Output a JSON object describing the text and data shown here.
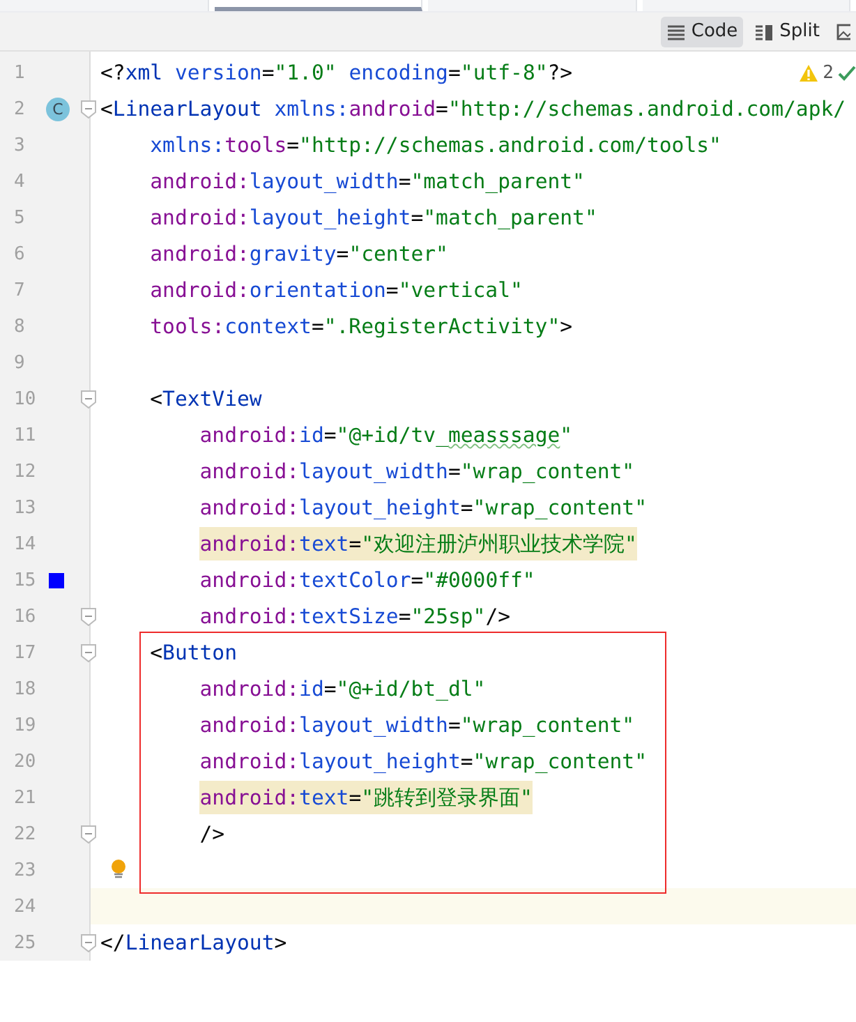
{
  "tabs": [
    {
      "selected": false
    },
    {
      "selected": true
    },
    {
      "selected": false
    },
    {
      "selected": false
    }
  ],
  "view_modes": [
    {
      "label": "Code",
      "kind": "code",
      "selected": true
    },
    {
      "label": "Split",
      "kind": "split",
      "selected": false
    },
    {
      "kind": "design",
      "selected": false
    }
  ],
  "inspections": {
    "warnings": "2"
  },
  "lines": [
    {
      "number": "1",
      "kind": "top",
      "highlighted": false,
      "tokens": [
        {
          "kind": "punct",
          "text": "<?"
        },
        {
          "kind": "tag",
          "text": "xml "
        },
        {
          "kind": "attr",
          "text": "version"
        },
        {
          "kind": "punct",
          "text": "="
        },
        {
          "kind": "value",
          "text": "\"1.0\" "
        },
        {
          "kind": "attr",
          "text": "encoding"
        },
        {
          "kind": "punct",
          "text": "="
        },
        {
          "kind": "value",
          "text": "\"utf-8\""
        },
        {
          "kind": "punct",
          "text": "?>"
        }
      ]
    },
    {
      "number": "2",
      "kind": "top",
      "badge": "C",
      "fold": true,
      "highlighted": false,
      "tokens": [
        {
          "kind": "punct",
          "text": "<"
        },
        {
          "kind": "tag",
          "text": "LinearLayout "
        },
        {
          "kind": "attr",
          "text": "xmlns:"
        },
        {
          "kind": "ns",
          "text": "android"
        },
        {
          "kind": "punct",
          "text": "="
        },
        {
          "kind": "value",
          "text": "\"http://schemas.android.com/apk/"
        }
      ]
    },
    {
      "number": "3",
      "kind": "nested",
      "highlighted": false,
      "tokens": [
        {
          "kind": "attr",
          "text": "xmlns:"
        },
        {
          "kind": "ns",
          "text": "tools"
        },
        {
          "kind": "punct",
          "text": "="
        },
        {
          "kind": "value",
          "text": "\"http://schemas.android.com/tools\""
        }
      ]
    },
    {
      "number": "4",
      "kind": "nested",
      "highlighted": false,
      "tokens": [
        {
          "kind": "ns",
          "text": "android:"
        },
        {
          "kind": "attr",
          "text": "layout_width"
        },
        {
          "kind": "punct",
          "text": "="
        },
        {
          "kind": "value",
          "text": "\"match_parent\""
        }
      ]
    },
    {
      "number": "5",
      "kind": "nested",
      "highlighted": false,
      "tokens": [
        {
          "kind": "ns",
          "text": "android:"
        },
        {
          "kind": "attr",
          "text": "layout_height"
        },
        {
          "kind": "punct",
          "text": "="
        },
        {
          "kind": "value",
          "text": "\"match_parent\""
        }
      ]
    },
    {
      "number": "6",
      "kind": "nested",
      "highlighted": false,
      "tokens": [
        {
          "kind": "ns",
          "text": "android:"
        },
        {
          "kind": "attr",
          "text": "gravity"
        },
        {
          "kind": "punct",
          "text": "="
        },
        {
          "kind": "value",
          "text": "\"center\""
        }
      ]
    },
    {
      "number": "7",
      "kind": "nested",
      "highlighted": false,
      "tokens": [
        {
          "kind": "ns",
          "text": "android:"
        },
        {
          "kind": "attr",
          "text": "orientation"
        },
        {
          "kind": "punct",
          "text": "="
        },
        {
          "kind": "value",
          "text": "\"vertical\""
        }
      ]
    },
    {
      "number": "8",
      "kind": "nested",
      "highlighted": false,
      "tokens": [
        {
          "kind": "ns",
          "text": "tools:"
        },
        {
          "kind": "attr",
          "text": "context"
        },
        {
          "kind": "punct",
          "text": "="
        },
        {
          "kind": "value",
          "text": "\".RegisterActivity\""
        },
        {
          "kind": "punct",
          "text": ">"
        }
      ]
    },
    {
      "number": "9",
      "kind": "top"
    },
    {
      "number": "10",
      "kind": "nested",
      "fold": true,
      "highlighted": false,
      "tokens": [
        {
          "kind": "punct",
          "text": "<"
        },
        {
          "kind": "tag",
          "text": "TextView"
        }
      ]
    },
    {
      "number": "11",
      "kind": "deep",
      "highlighted": false,
      "tokens": [
        {
          "kind": "ns",
          "text": "android:"
        },
        {
          "kind": "attr",
          "text": "id"
        },
        {
          "kind": "punct",
          "text": "="
        },
        {
          "kind": "value",
          "text": "\"@+id/tv_"
        },
        {
          "kind": "value",
          "text": "measssage",
          "warn": true
        },
        {
          "kind": "value",
          "text": "\""
        }
      ]
    },
    {
      "number": "12",
      "kind": "deep",
      "highlighted": false,
      "tokens": [
        {
          "kind": "ns",
          "text": "android:"
        },
        {
          "kind": "attr",
          "text": "layout_width"
        },
        {
          "kind": "punct",
          "text": "="
        },
        {
          "kind": "value",
          "text": "\"wrap_content\""
        }
      ]
    },
    {
      "number": "13",
      "kind": "deep",
      "highlighted": false,
      "tokens": [
        {
          "kind": "ns",
          "text": "android:"
        },
        {
          "kind": "attr",
          "text": "layout_height"
        },
        {
          "kind": "punct",
          "text": "="
        },
        {
          "kind": "value",
          "text": "\"wrap_content\""
        }
      ]
    },
    {
      "number": "14",
      "kind": "deep",
      "highlighted": true,
      "tokens": [
        {
          "kind": "ns",
          "text": "android:"
        },
        {
          "kind": "attr",
          "text": "text"
        },
        {
          "kind": "punct",
          "text": "="
        },
        {
          "kind": "value",
          "text": "\"欢迎注册泸州职业技术学院\""
        }
      ]
    },
    {
      "number": "15",
      "kind": "deep",
      "color": "#0000ff",
      "highlighted": false,
      "tokens": [
        {
          "kind": "ns",
          "text": "android:"
        },
        {
          "kind": "attr",
          "text": "textColor"
        },
        {
          "kind": "punct",
          "text": "="
        },
        {
          "kind": "value",
          "text": "\"#0000ff\""
        }
      ]
    },
    {
      "number": "16",
      "kind": "deep",
      "fold": true,
      "highlighted": false,
      "tokens": [
        {
          "kind": "ns",
          "text": "android:"
        },
        {
          "kind": "attr",
          "text": "textSize"
        },
        {
          "kind": "punct",
          "text": "="
        },
        {
          "kind": "value",
          "text": "\"25sp\""
        },
        {
          "kind": "punct",
          "text": "/>"
        }
      ]
    },
    {
      "number": "17",
      "kind": "nested",
      "fold": true,
      "highlighted": false,
      "tokens": [
        {
          "kind": "punct",
          "text": "<"
        },
        {
          "kind": "tag",
          "text": "Button"
        }
      ]
    },
    {
      "number": "18",
      "kind": "deep",
      "highlighted": false,
      "tokens": [
        {
          "kind": "ns",
          "text": "android:"
        },
        {
          "kind": "attr",
          "text": "id"
        },
        {
          "kind": "punct",
          "text": "="
        },
        {
          "kind": "value",
          "text": "\"@+id/bt_dl\""
        }
      ]
    },
    {
      "number": "19",
      "kind": "deep",
      "highlighted": false,
      "tokens": [
        {
          "kind": "ns",
          "text": "android:"
        },
        {
          "kind": "attr",
          "text": "layout_width"
        },
        {
          "kind": "punct",
          "text": "="
        },
        {
          "kind": "value",
          "text": "\"wrap_content\""
        }
      ]
    },
    {
      "number": "20",
      "kind": "deep",
      "highlighted": false,
      "tokens": [
        {
          "kind": "ns",
          "text": "android:"
        },
        {
          "kind": "attr",
          "text": "layout_height"
        },
        {
          "kind": "punct",
          "text": "="
        },
        {
          "kind": "value",
          "text": "\"wrap_content\""
        }
      ]
    },
    {
      "number": "21",
      "kind": "deep",
      "highlighted": true,
      "tokens": [
        {
          "kind": "ns",
          "text": "android:"
        },
        {
          "kind": "attr",
          "text": "text"
        },
        {
          "kind": "punct",
          "text": "="
        },
        {
          "kind": "value",
          "text": "\"跳转到登录界面\""
        }
      ]
    },
    {
      "number": "22",
      "kind": "deep",
      "fold": true,
      "highlighted": false,
      "tokens": [
        {
          "kind": "punct",
          "text": "/>"
        }
      ]
    },
    {
      "number": "23",
      "kind": "top",
      "bulb": true
    },
    {
      "number": "24",
      "kind": "top",
      "current": true
    },
    {
      "number": "25",
      "kind": "top",
      "fold": true,
      "highlighted": false,
      "tokens": [
        {
          "kind": "punct",
          "text": "</"
        },
        {
          "kind": "tag",
          "text": "LinearLayout"
        },
        {
          "kind": "punct",
          "text": ">"
        }
      ]
    }
  ]
}
